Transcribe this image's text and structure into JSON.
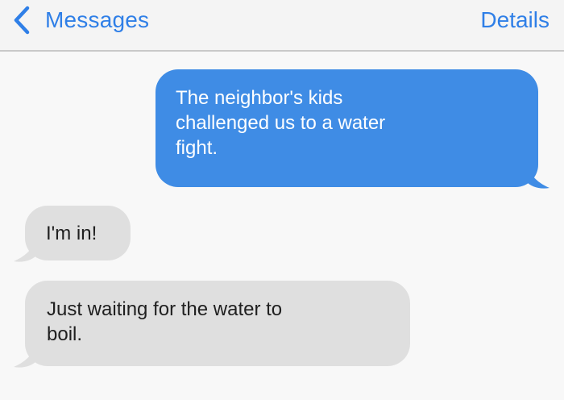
{
  "nav": {
    "back_label": "Messages",
    "details_label": "Details",
    "back_icon": "chevron-left-icon",
    "accent_color": "#2f7fe7"
  },
  "messages": [
    {
      "direction": "sent",
      "text": "The neighbor's kids challenged us to a water fight.",
      "lines": [
        "The neighbor's kids",
        "challenged us to a water",
        "fight."
      ]
    },
    {
      "direction": "received",
      "text": "I'm in!",
      "lines": [
        "I'm in!"
      ]
    },
    {
      "direction": "received",
      "text": "Just waiting for the water to boil.",
      "lines": [
        "Just waiting for the water to",
        "boil."
      ]
    }
  ],
  "colors": {
    "sent_bubble": "#3f8ce5",
    "received_bubble": "#dfdfdf",
    "background": "#f8f8f8"
  }
}
